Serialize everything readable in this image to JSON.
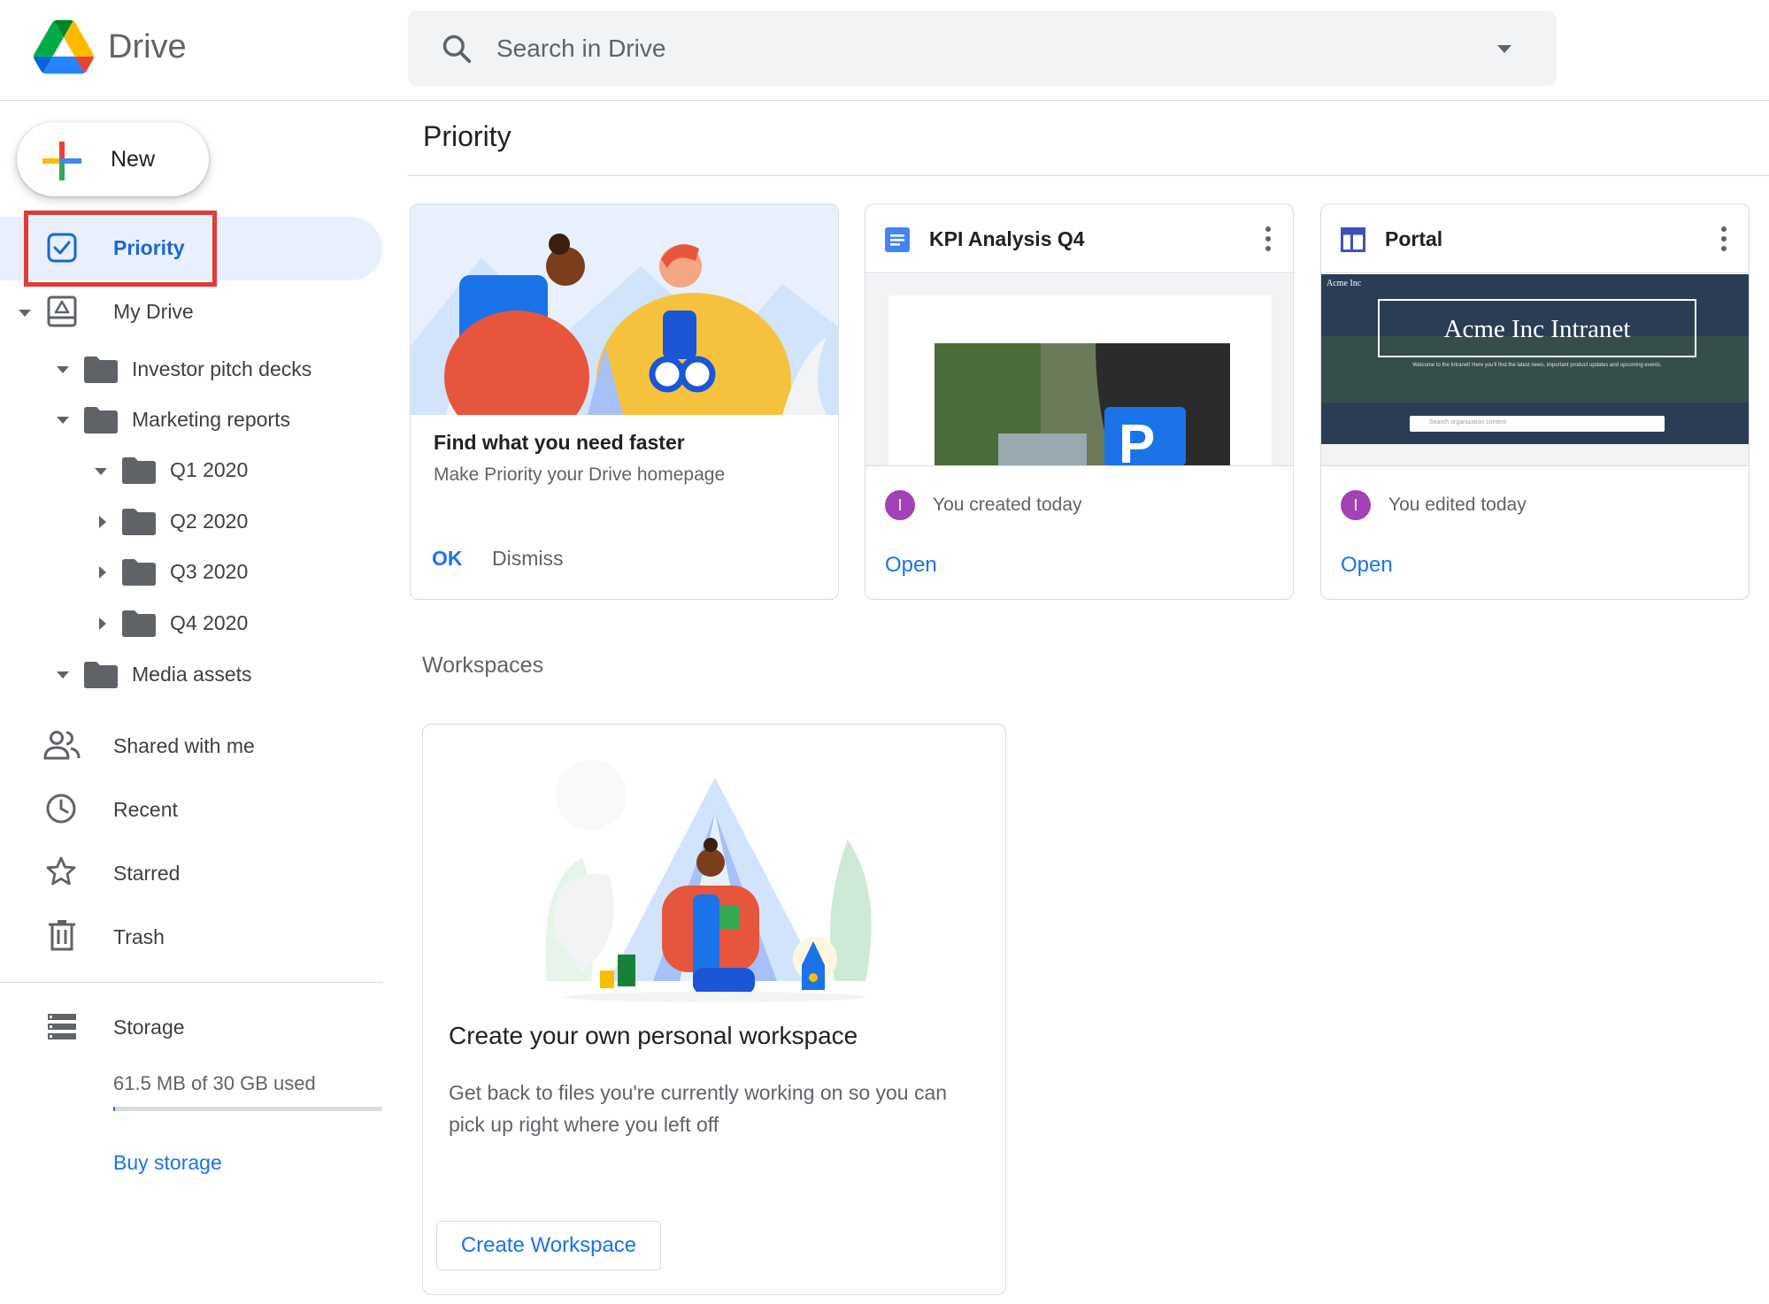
{
  "app": {
    "name": "Drive"
  },
  "search": {
    "placeholder": "Search in Drive"
  },
  "new_button": {
    "label": "New"
  },
  "sidebar": {
    "priority": "Priority",
    "my_drive": "My Drive",
    "tree": [
      {
        "label": "Investor pitch decks",
        "level": 1,
        "expanded": true
      },
      {
        "label": "Marketing reports",
        "level": 1,
        "expanded": true
      },
      {
        "label": "Q1 2020",
        "level": 2,
        "expanded": true
      },
      {
        "label": "Q2 2020",
        "level": 2,
        "expanded": false
      },
      {
        "label": "Q3 2020",
        "level": 2,
        "expanded": false
      },
      {
        "label": "Q4 2020",
        "level": 2,
        "expanded": false
      },
      {
        "label": "Media assets",
        "level": 1,
        "expanded": true
      }
    ],
    "shared": "Shared with me",
    "recent": "Recent",
    "starred": "Starred",
    "trash": "Trash",
    "storage": "Storage",
    "storage_used": "61.5 MB of 30 GB used",
    "storage_fraction": 0.002,
    "buy_storage": "Buy storage"
  },
  "main": {
    "title": "Priority",
    "intro_card": {
      "title": "Find what you need faster",
      "subtitle": "Make Priority your Drive homepage",
      "ok": "OK",
      "dismiss": "Dismiss"
    },
    "files": [
      {
        "title": "KPI Analysis Q4",
        "icon": "docs-icon",
        "avatar": "I",
        "activity": "You created today",
        "open": "Open"
      },
      {
        "title": "Portal",
        "icon": "sites-icon",
        "avatar": "I",
        "activity": "You edited today",
        "open": "Open",
        "preview_brand": "Acme Inc",
        "preview_title": "Acme Inc Intranet",
        "preview_sub": "Welcome to the Intranet! Here you'll find the latest news, important product updates and upcoming events.",
        "preview_search": "Search organization content"
      }
    ],
    "workspaces": {
      "section_title": "Workspaces",
      "card_title": "Create your own personal workspace",
      "card_desc": "Get back to files you're currently working on so you can pick up right where you left off",
      "button": "Create Workspace"
    }
  },
  "colors": {
    "accent": "#1a73e8",
    "highlight": "#e53935",
    "avatar": "#a142b5"
  }
}
